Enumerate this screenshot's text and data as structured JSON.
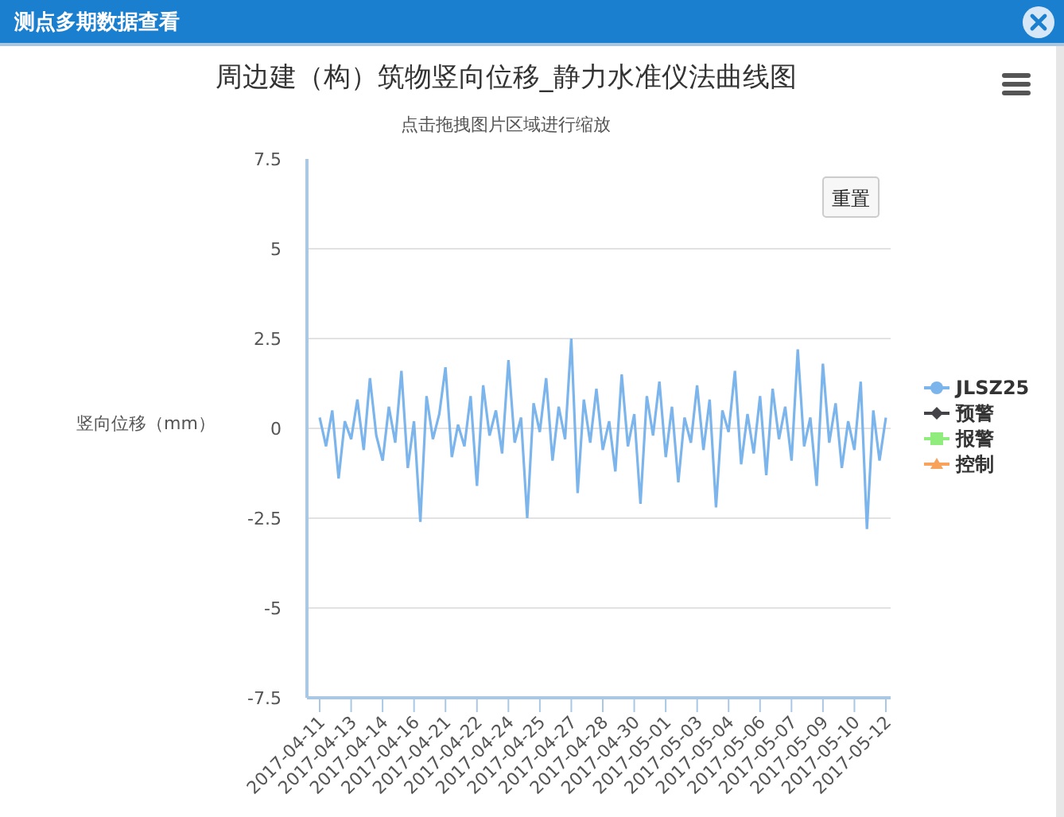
{
  "window": {
    "title": "测点多期数据查看"
  },
  "chart": {
    "subtitle": "点击拖拽图片区域进行缩放",
    "reset_button": "重置",
    "chart_data": {
      "type": "line",
      "title": "周边建（构）筑物竖向位移_静力水准仪法曲线图",
      "ylabel": "竖向位移（mm）",
      "grid": true,
      "ylim": [
        -7.5,
        7.5
      ],
      "yticks": [
        7.5,
        5,
        2.5,
        0,
        -2.5,
        -5,
        -7.5
      ],
      "categories": [
        "2017-04-11",
        null,
        null,
        null,
        null,
        "2017-04-13",
        null,
        null,
        null,
        null,
        "2017-04-14",
        null,
        null,
        null,
        null,
        "2017-04-16",
        null,
        null,
        null,
        null,
        "2017-04-21",
        null,
        null,
        null,
        null,
        "2017-04-22",
        null,
        null,
        null,
        null,
        "2017-04-24",
        null,
        null,
        null,
        null,
        "2017-04-25",
        null,
        null,
        null,
        null,
        "2017-04-27",
        null,
        null,
        null,
        null,
        "2017-04-28",
        null,
        null,
        null,
        null,
        "2017-04-30",
        null,
        null,
        null,
        null,
        "2017-05-01",
        null,
        null,
        null,
        null,
        "2017-05-03",
        null,
        null,
        null,
        null,
        "2017-05-04",
        null,
        null,
        null,
        null,
        "2017-05-06",
        null,
        null,
        null,
        null,
        "2017-05-07",
        null,
        null,
        null,
        null,
        "2017-05-09",
        null,
        null,
        null,
        null,
        "2017-05-10",
        null,
        null,
        null,
        null,
        "2017-05-12"
      ],
      "series": [
        {
          "name": "JLSZ25",
          "color": "#7cb5ec",
          "values": [
            0.3,
            -0.5,
            0.5,
            -1.4,
            0.2,
            -0.3,
            0.8,
            -0.6,
            1.4,
            -0.2,
            -0.9,
            0.6,
            -0.4,
            1.6,
            -1.1,
            0.2,
            -2.6,
            0.9,
            -0.3,
            0.4,
            1.7,
            -0.8,
            0.1,
            -0.5,
            0.9,
            -1.6,
            1.2,
            -0.2,
            0.5,
            -0.7,
            1.9,
            -0.4,
            0.3,
            -2.5,
            0.7,
            -0.1,
            1.4,
            -0.9,
            0.6,
            -0.3,
            2.5,
            -1.8,
            0.8,
            -0.4,
            1.1,
            -0.6,
            0.2,
            -1.2,
            1.5,
            -0.5,
            0.4,
            -2.1,
            0.9,
            -0.2,
            1.3,
            -0.8,
            0.6,
            -1.5,
            0.3,
            -0.4,
            1.2,
            -0.6,
            0.8,
            -2.2,
            0.5,
            -0.1,
            1.6,
            -1.0,
            0.4,
            -0.7,
            0.9,
            -1.3,
            1.1,
            -0.3,
            0.6,
            -0.9,
            2.2,
            -0.5,
            0.3,
            -1.6,
            1.8,
            -0.4,
            0.7,
            -1.1,
            0.2,
            -0.6,
            1.3,
            -2.8,
            0.5,
            -0.9,
            0.3
          ]
        }
      ]
    },
    "legend": [
      {
        "name": "预警",
        "kind": "diamond",
        "color": "#434348"
      },
      {
        "name": "报警",
        "kind": "square",
        "color": "#90ed7d"
      },
      {
        "name": "控制",
        "kind": "triangle",
        "color": "#f7a35c"
      }
    ]
  }
}
